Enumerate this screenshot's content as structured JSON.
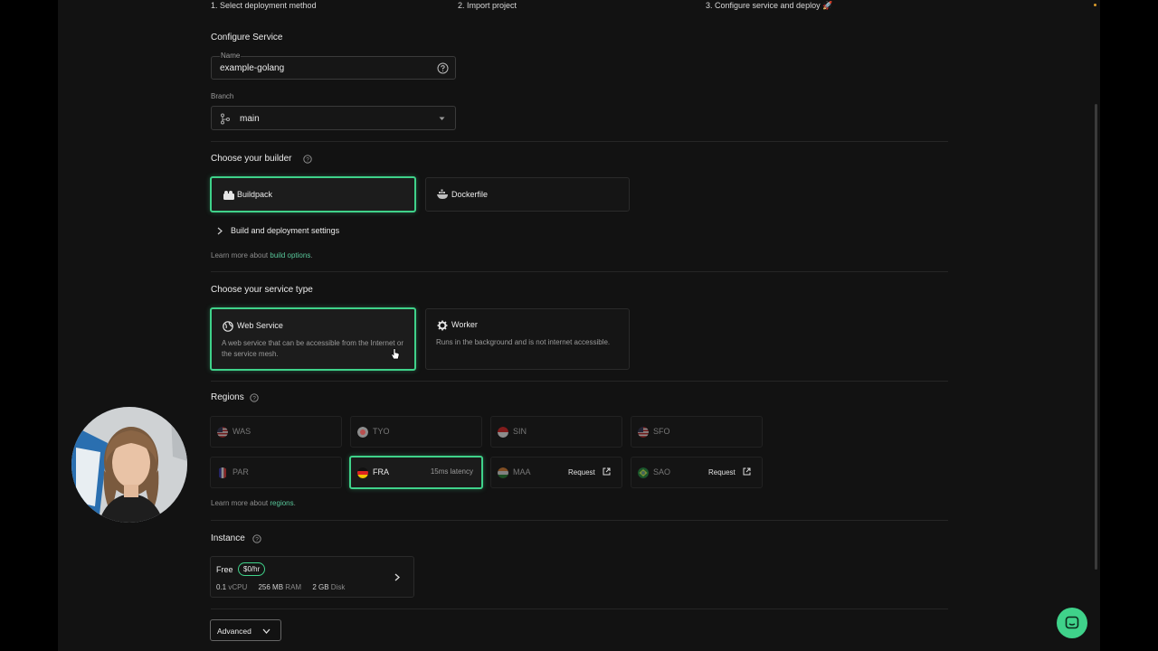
{
  "steps": [
    "1. Select deployment method",
    "2. Import project",
    "3. Configure service and deploy 🚀"
  ],
  "configure": {
    "title": "Configure Service",
    "name_label": "Name",
    "name_value": "example-golang",
    "branch_label": "Branch",
    "branch_value": "main"
  },
  "builder": {
    "title": "Choose your builder",
    "options": [
      "Buildpack",
      "Dockerfile"
    ],
    "selected": "Buildpack",
    "settings_label": "Build and deployment settings",
    "learn_prefix": "Learn more about",
    "learn_link": "build options",
    "learn_suffix": "."
  },
  "service_type": {
    "title": "Choose your service type",
    "options": [
      {
        "title": "Web Service",
        "desc": "A web service that can be accessible from the Internet or the service mesh."
      },
      {
        "title": "Worker",
        "desc": "Runs in the background and is not internet accessible."
      }
    ],
    "selected": "Web Service"
  },
  "regions": {
    "title": "Regions",
    "items": [
      {
        "code": "WAS",
        "flag": "us"
      },
      {
        "code": "TYO",
        "flag": "jp"
      },
      {
        "code": "SIN",
        "flag": "sg"
      },
      {
        "code": "SFO",
        "flag": "us"
      },
      {
        "code": "PAR",
        "flag": "fr"
      },
      {
        "code": "FRA",
        "flag": "de",
        "latency": "15ms latency"
      },
      {
        "code": "MAA",
        "flag": "in",
        "request": "Request"
      },
      {
        "code": "SAO",
        "flag": "br",
        "request": "Request"
      }
    ],
    "selected": "FRA",
    "learn_prefix": "Learn more about",
    "learn_link": "regions",
    "learn_suffix": "."
  },
  "instance": {
    "title": "Instance",
    "tier": "Free",
    "price": "$0/hr",
    "specs": [
      {
        "value": "0.1",
        "unit": "vCPU"
      },
      {
        "value": "256 MB",
        "unit": "RAM"
      },
      {
        "value": "2 GB",
        "unit": "Disk"
      }
    ]
  },
  "advanced_label": "Advanced",
  "colors": {
    "accent": "#3fd28a",
    "background": "#121212"
  }
}
